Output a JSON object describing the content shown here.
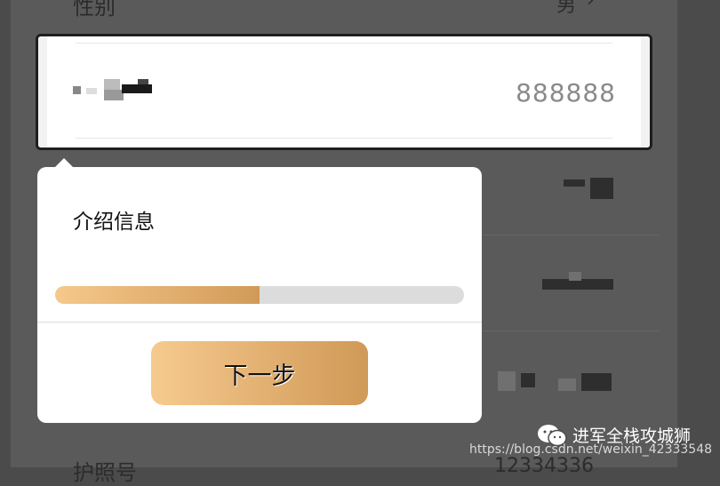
{
  "background": {
    "top_row_label": "性别",
    "top_row_value": "男",
    "top_row_chevron": "chevron-right-icon",
    "bottom_row_label": "护照号",
    "bottom_row_value": "12334336"
  },
  "highlighted_row": {
    "value": "888888"
  },
  "popover": {
    "title": "介绍信息",
    "progress_fraction": 0.5,
    "next_button_label": "下一步"
  },
  "watermark": {
    "brand": "进军全栈攻城狮",
    "url": "https://blog.csdn.net/weixin_42333548"
  },
  "colors": {
    "accent_start": "#f6ca8e",
    "accent_end": "#d09957",
    "track": "#dcdcdc",
    "overlay": "#4b4b4b"
  }
}
